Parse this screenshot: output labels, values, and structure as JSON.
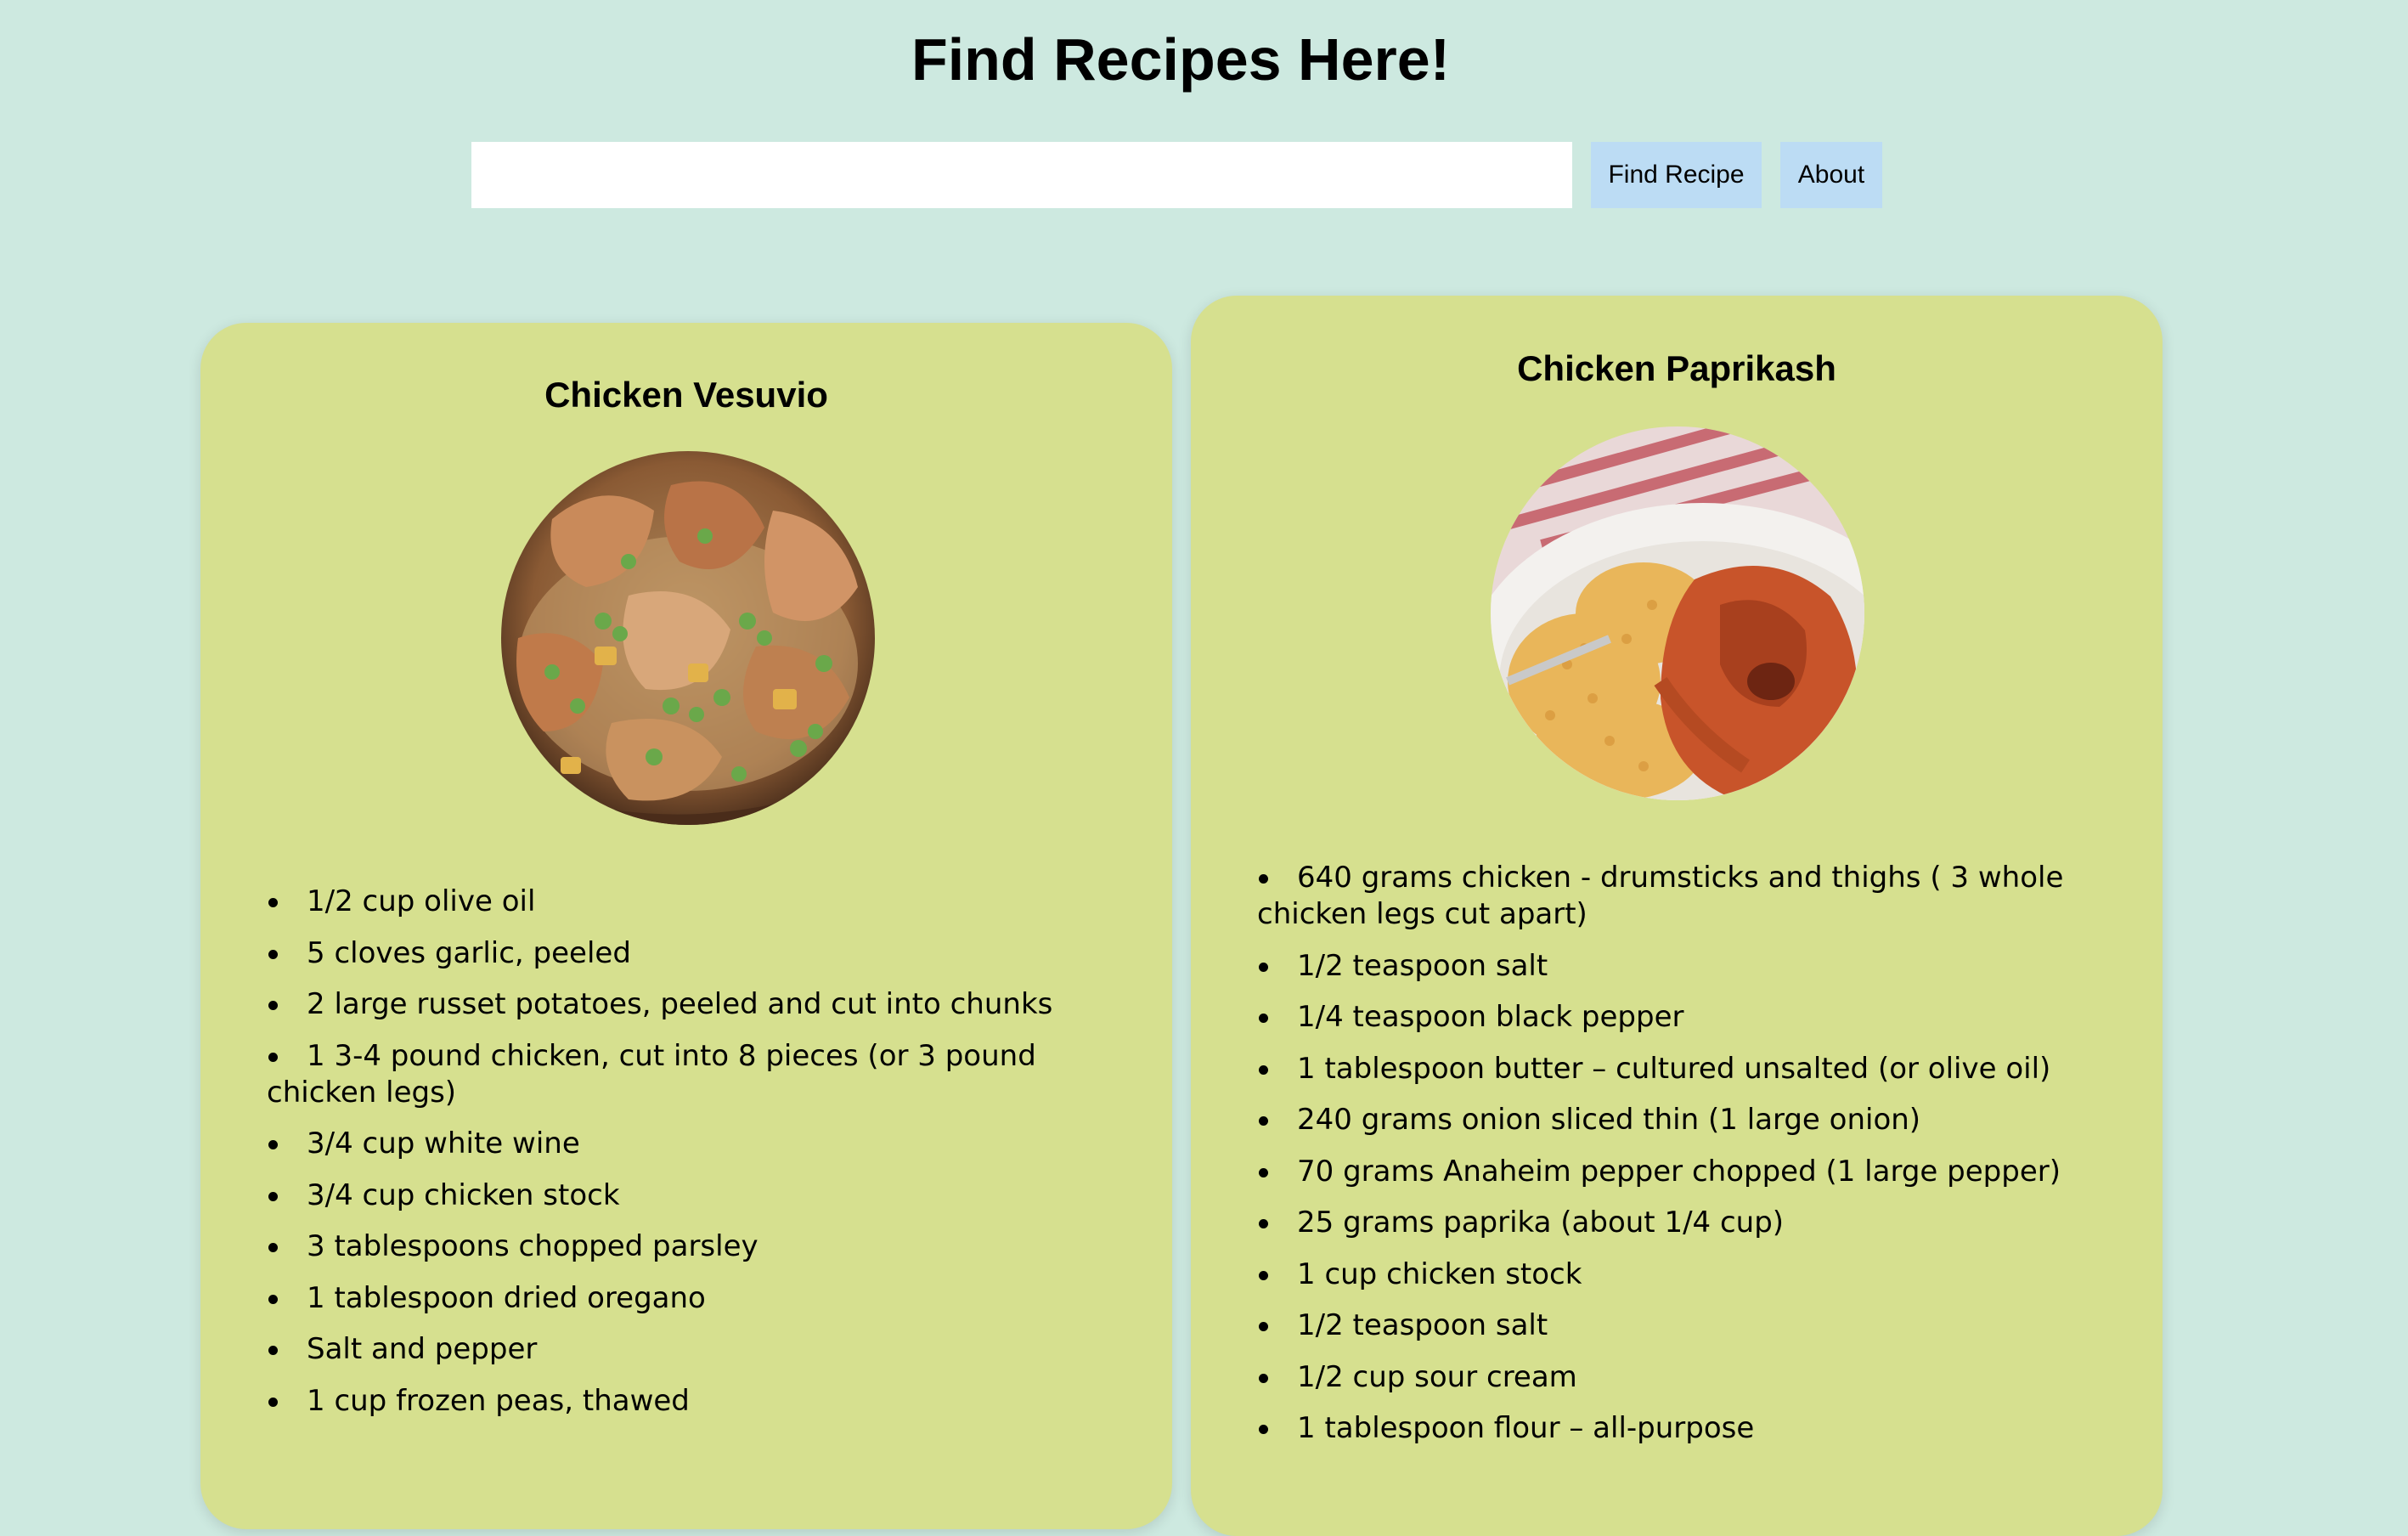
{
  "header": {
    "title": "Find Recipes Here!"
  },
  "search": {
    "value": "",
    "placeholder": "",
    "find_label": "Find Recipe",
    "about_label": "About"
  },
  "recipes": [
    {
      "title": "Chicken Vesuvio",
      "ingredients": [
        "1/2 cup olive oil",
        "5 cloves garlic, peeled",
        "2 large russet potatoes, peeled and cut into chunks",
        "1 3-4 pound chicken, cut into 8 pieces (or 3 pound chicken legs)",
        "3/4 cup white wine",
        "3/4 cup chicken stock",
        "3 tablespoons chopped parsley",
        "1 tablespoon dried oregano",
        "Salt and pepper",
        "1 cup frozen peas, thawed"
      ]
    },
    {
      "title": "Chicken Paprikash",
      "ingredients": [
        "640 grams chicken - drumsticks and thighs ( 3 whole chicken legs cut apart)",
        "1/2 teaspoon salt",
        "1/4 teaspoon black pepper",
        "1 tablespoon butter – cultured unsalted (or olive oil)",
        "240 grams onion sliced thin (1 large onion)",
        "70 grams Anaheim pepper chopped (1 large pepper)",
        "25 grams paprika (about 1/4 cup)",
        "1 cup chicken stock",
        "1/2 teaspoon salt",
        "1/2 cup sour cream",
        "1 tablespoon flour – all-purpose"
      ]
    }
  ],
  "colors": {
    "background": "#cde9e0",
    "card": "#d6e08f",
    "button": "#bcdcf4",
    "input": "#ffffff"
  }
}
